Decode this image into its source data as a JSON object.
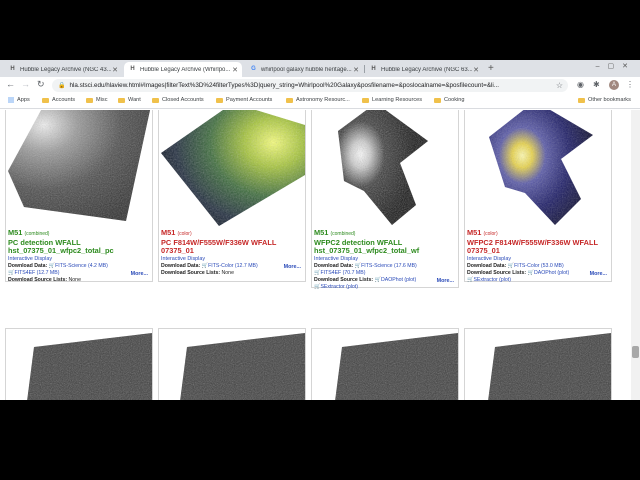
{
  "tabs": [
    {
      "favicon": "H",
      "title": "Hubble Legacy Archive (NGC 43..."
    },
    {
      "favicon": "H",
      "title": "Hubble Legacy Archive (Whirlpo..."
    },
    {
      "favicon": "G",
      "title": "whirlpool galaxy hubble heritage..."
    },
    {
      "favicon": "H",
      "title": "Hubble Legacy Archive (NGC 63..."
    }
  ],
  "toolbar": {
    "url": "hla.stsci.edu/hlaview.html#Images|filterText%3D%24filterTypes%3D|query_string=Whirlpool%20Galaxy&posfilename=&poslocalname=&posfilecount=&li...",
    "avatar_letter": "A"
  },
  "bookmarks": [
    {
      "label": "Apps",
      "icon": "apps-grid-icon"
    },
    {
      "label": "Accounts",
      "icon": "folder-icon"
    },
    {
      "label": "Misc",
      "icon": "folder-icon"
    },
    {
      "label": "Want",
      "icon": "folder-icon"
    },
    {
      "label": "Closed Accounts",
      "icon": "folder-icon"
    },
    {
      "label": "Payment Accounts",
      "icon": "folder-icon"
    },
    {
      "label": "Astronomy Resourc...",
      "icon": "folder-icon"
    },
    {
      "label": "Learning Resources",
      "icon": "folder-icon"
    },
    {
      "label": "Cooking",
      "icon": "folder-icon"
    },
    {
      "label": "Other bookmarks",
      "icon": "folder-icon"
    }
  ],
  "cards": [
    {
      "name": "M51",
      "tag": "(combined)",
      "color": "green",
      "line2": "PC detection WFALL",
      "line3": "hst_07375_01_wfpc2_total_pc",
      "interactive": "Interactive Display",
      "dl_label": "Download Data:",
      "dl1": "FITS-Science (4.2 MB)",
      "dl2": "FITS4EF (12.7 MB)",
      "src_label": "Download Source Lists:",
      "src_value": "None",
      "more": "More..."
    },
    {
      "name": "M51",
      "tag": "(color)",
      "color": "red",
      "line2": "PC F814W/F555W/F336W WFALL",
      "line3": "07375_01",
      "interactive": "Interactive Display",
      "dl_label": "Download Data:",
      "dl1": "FITS-Color (12.7 MB)",
      "dl2": "",
      "src_label": "Download Source Lists:",
      "src_value": "None",
      "more": "More..."
    },
    {
      "name": "M51",
      "tag": "(combined)",
      "color": "green",
      "line2": "WFPC2 detection WFALL",
      "line3": "hst_07375_01_wfpc2_total_wf",
      "interactive": "Interactive Display",
      "dl_label": "Download Data:",
      "dl1": "FITS-Science (17.6 MB)",
      "dl2": "FITS4EF (70.7 MB)",
      "src_label": "Download Source Lists:",
      "src_value": "DAOPhot (plot)",
      "src_extra": "SExtractor (plot)",
      "more": "More..."
    },
    {
      "name": "M51",
      "tag": "(color)",
      "color": "red",
      "line2": "WFPC2 F814W/F555W/F336W WFALL",
      "line3": "07375_01",
      "interactive": "Interactive Display",
      "dl_label": "Download Data:",
      "dl1": "FITS-Color (53.0 MB)",
      "dl2": "",
      "src_label": "Download Source Lists:",
      "src_value": "DAOPhot (plot)",
      "src_extra": "SExtractor (plot)",
      "more": "More..."
    }
  ],
  "colors": {
    "green": "#2e8b1f",
    "red": "#c62828",
    "link": "#2a4ab8"
  }
}
